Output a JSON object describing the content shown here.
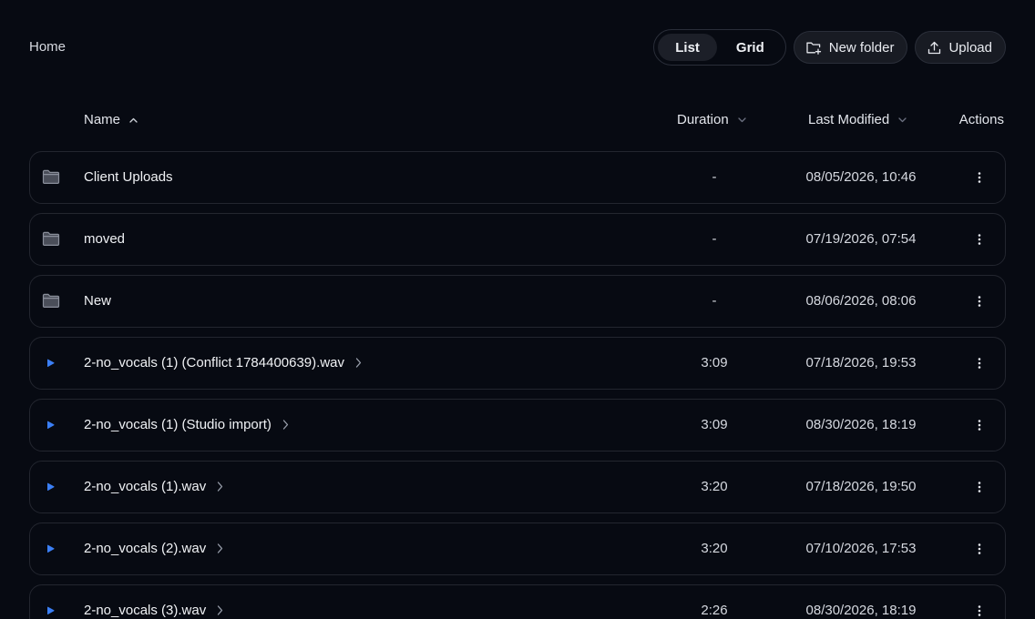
{
  "breadcrumb": {
    "home": "Home"
  },
  "toolbar": {
    "view_list": "List",
    "view_grid": "Grid",
    "active_view": "List",
    "new_folder": "New folder",
    "upload": "Upload"
  },
  "table": {
    "columns": {
      "name": "Name",
      "duration": "Duration",
      "modified": "Last Modified",
      "actions": "Actions"
    },
    "rows": [
      {
        "type": "folder",
        "name": "Client Uploads",
        "duration": "-",
        "modified": "08/05/2026, 10:46"
      },
      {
        "type": "folder",
        "name": "moved",
        "duration": "-",
        "modified": "07/19/2026, 07:54"
      },
      {
        "type": "folder",
        "name": "New",
        "duration": "-",
        "modified": "08/06/2026, 08:06"
      },
      {
        "type": "audio",
        "name": "2-no_vocals (1) (Conflict 1784400639).wav",
        "duration": "3:09",
        "modified": "07/18/2026, 19:53"
      },
      {
        "type": "audio",
        "name": "2-no_vocals (1) (Studio import)",
        "duration": "3:09",
        "modified": "08/30/2026, 18:19"
      },
      {
        "type": "audio",
        "name": "2-no_vocals (1).wav",
        "duration": "3:20",
        "modified": "07/18/2026, 19:50"
      },
      {
        "type": "audio",
        "name": "2-no_vocals (2).wav",
        "duration": "3:20",
        "modified": "07/10/2026, 17:53"
      },
      {
        "type": "audio",
        "name": "2-no_vocals (3).wav",
        "duration": "2:26",
        "modified": "08/30/2026, 18:19"
      }
    ]
  },
  "icons": {
    "folder": "folder-icon",
    "audio": "play-icon",
    "expand": "chevron-right-icon",
    "menu": "more-vertical-icon",
    "sort_asc": "chevron-up-icon",
    "sort_desc": "chevron-down-icon",
    "new_folder": "folder-plus-icon",
    "upload": "upload-icon"
  },
  "colors": {
    "background": "#070a12",
    "accent_play": "#3b7ff5",
    "border": "#23262f"
  }
}
